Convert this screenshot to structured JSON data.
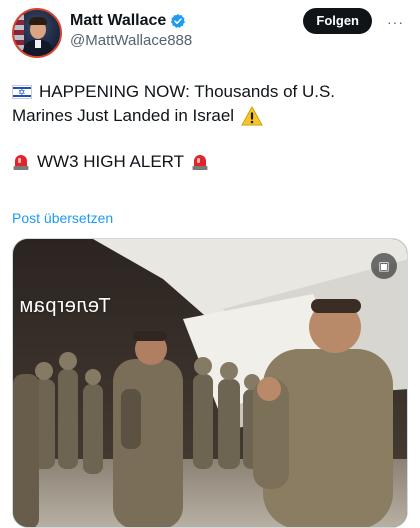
{
  "author": {
    "name": "Matt Wallace",
    "handle": "@MattWallace888",
    "verified": true
  },
  "header": {
    "follow_label": "Folgen",
    "more_label": "···"
  },
  "tweet": {
    "line1": "HAPPENING NOW: Thousands of U.S.",
    "line2": "Marines Just Landed in Israel",
    "line3": "WW3 HIGH ALERT",
    "translate_label": "Post übersetzen"
  },
  "media": {
    "watermark_text": "Телеграм",
    "icons": [
      "israel-flag-icon",
      "warning-icon",
      "siren-icon",
      "gif-icon"
    ]
  },
  "colors": {
    "accent": "#1d9bf0",
    "follow_bg": "#0f1419",
    "secondary_text": "#536471",
    "siren_red": "#e0242b",
    "warning_yellow": "#f7c52a"
  }
}
